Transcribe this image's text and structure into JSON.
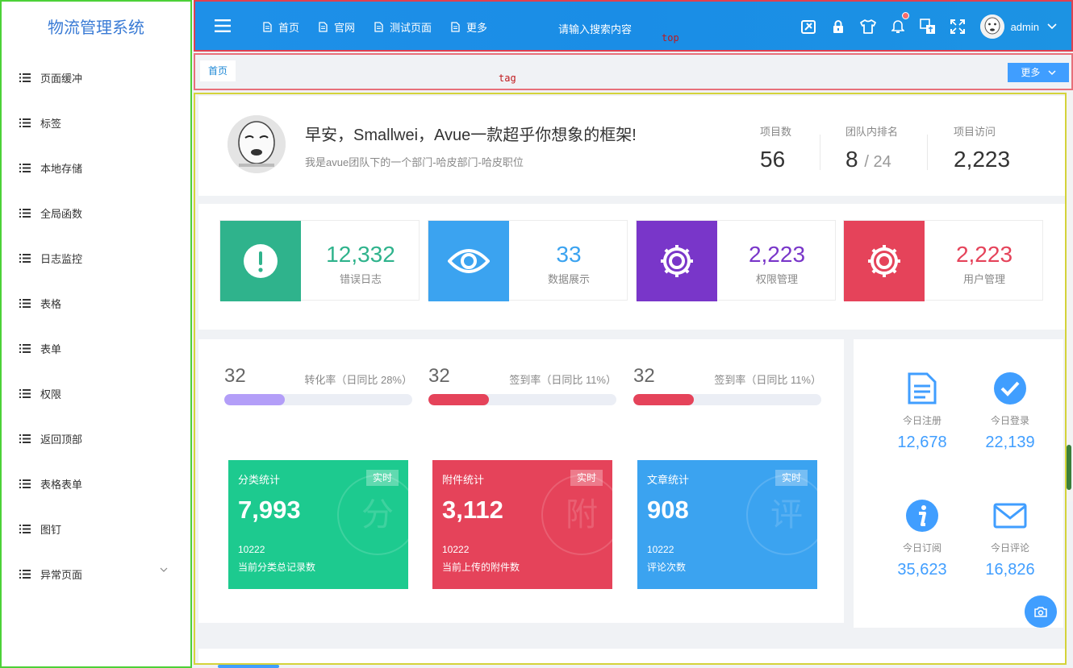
{
  "sidebar": {
    "title": "物流管理系统",
    "items": [
      {
        "label": "页面缓冲"
      },
      {
        "label": "标签"
      },
      {
        "label": "本地存储"
      },
      {
        "label": "全局函数"
      },
      {
        "label": "日志监控"
      },
      {
        "label": "表格"
      },
      {
        "label": "表单"
      },
      {
        "label": "权限"
      },
      {
        "label": "返回顶部"
      },
      {
        "label": "表格表单"
      },
      {
        "label": "图钉"
      },
      {
        "label": "异常页面"
      }
    ]
  },
  "top": {
    "nav": [
      {
        "label": "首页"
      },
      {
        "label": "官网"
      },
      {
        "label": "测试页面"
      },
      {
        "label": "更多"
      }
    ],
    "search_placeholder": "请输入搜索内容",
    "marker": "top",
    "user": "admin",
    "icons": [
      "theme-icon",
      "lock-icon",
      "shirt-icon",
      "bell-icon",
      "translate-icon",
      "fullscreen-icon"
    ]
  },
  "tagbar": {
    "tag": "首页",
    "marker": "tag",
    "more": "更多"
  },
  "welcome": {
    "title": "早安，Smallwei，Avue一款超乎你想象的框架!",
    "subtitle": "我是avue团队下的一个部门-哈皮部门-哈皮职位",
    "stats": [
      {
        "label": "项目数",
        "value": "56"
      },
      {
        "label": "团队内排名",
        "value": "8",
        "extra": "/ 24"
      },
      {
        "label": "项目访问",
        "value": "2,223"
      }
    ]
  },
  "cards": [
    {
      "value": "12,332",
      "label": "错误日志",
      "color": "#2fb38c",
      "icon": "warning-icon"
    },
    {
      "value": "33",
      "label": "数据展示",
      "color": "#3ba3f0",
      "icon": "eye-icon"
    },
    {
      "value": "2,223",
      "label": "权限管理",
      "color": "#7936c9",
      "icon": "gear-icon"
    },
    {
      "value": "2,223",
      "label": "用户管理",
      "color": "#e5435a",
      "icon": "gear-icon"
    }
  ],
  "progress": [
    {
      "value": "32",
      "label": "转化率（日同比 28%）",
      "percent": 32,
      "color": "#b39ef8"
    },
    {
      "value": "32",
      "label": "签到率（日同比 11%）",
      "percent": 32,
      "color": "#e5435a"
    },
    {
      "value": "32",
      "label": "签到率（日同比 11%）",
      "percent": 32,
      "color": "#e5435a"
    }
  ],
  "stat_cards": [
    {
      "title": "分类统计",
      "badge": "实时",
      "value": "7,993",
      "num": "10222",
      "desc": "当前分类总记录数",
      "color": "#1dca8f",
      "wm": "分"
    },
    {
      "title": "附件统计",
      "badge": "实时",
      "value": "3,112",
      "num": "10222",
      "desc": "当前上传的附件数",
      "color": "#e5435a",
      "wm": "附"
    },
    {
      "title": "文章统计",
      "badge": "实时",
      "value": "908",
      "num": "10222",
      "desc": "评论次数",
      "color": "#3ba3f0",
      "wm": "评"
    }
  ],
  "right": [
    {
      "label": "今日注册",
      "value": "12,678",
      "icon": "document-icon"
    },
    {
      "label": "今日登录",
      "value": "22,139",
      "icon": "check-circle-icon"
    },
    {
      "label": "今日订阅",
      "value": "35,623",
      "icon": "info-icon"
    },
    {
      "label": "今日评论",
      "value": "16,826",
      "icon": "mail-icon"
    }
  ]
}
